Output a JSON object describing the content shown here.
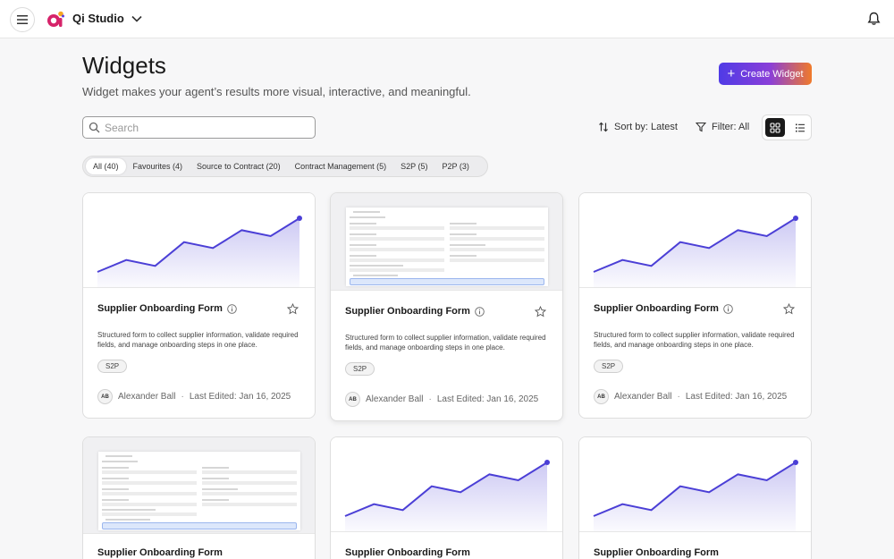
{
  "app": {
    "title": "Qi Studio",
    "logo_icon": "qi-logo-icon",
    "brand_colors": [
      "#d6236a",
      "#f6a623",
      "#5b3fe0"
    ]
  },
  "header": {
    "title": "Widgets",
    "subtitle": "Widget makes your agent’s results more visual, interactive, and meaningful.",
    "create_label": "Create Widget"
  },
  "search": {
    "placeholder": "Search",
    "value": ""
  },
  "toolbar": {
    "sort_label": "Sort by: Latest",
    "filter_label": "Filter: All",
    "view_mode": "grid"
  },
  "tabs": [
    {
      "label": "All (40)",
      "active": true
    },
    {
      "label": "Favourites (4)",
      "active": false
    },
    {
      "label": "Source to Contract (20)",
      "active": false
    },
    {
      "label": "Contract Management (5)",
      "active": false
    },
    {
      "label": "S2P (5)",
      "active": false
    },
    {
      "label": "P2P (3)",
      "active": false
    }
  ],
  "cards": [
    {
      "preview": "chart",
      "title": "Supplier Onboarding Form",
      "description": "Structured form to collect supplier information, validate required fields, and manage onboarding steps in one place.",
      "tag": "S2P",
      "author_initials": "AB",
      "author": "Alexander Ball",
      "edited": "Last Edited: Jan 16, 2025"
    },
    {
      "preview": "form",
      "title": "Supplier Onboarding Form",
      "description": "Structured form to collect supplier information, validate required fields, and manage onboarding steps in one place.",
      "tag": "S2P",
      "author_initials": "AB",
      "author": "Alexander Ball",
      "edited": "Last Edited: Jan 16, 2025"
    },
    {
      "preview": "chart",
      "title": "Supplier Onboarding Form",
      "description": "Structured form to collect supplier information, validate required fields, and manage onboarding steps in one place.",
      "tag": "S2P",
      "author_initials": "AB",
      "author": "Alexander Ball",
      "edited": "Last Edited: Jan 16, 2025"
    },
    {
      "preview": "form",
      "title": "Supplier Onboarding Form"
    },
    {
      "preview": "chart",
      "title": "Supplier Onboarding Form"
    },
    {
      "preview": "chart",
      "title": "Supplier Onboarding Form"
    }
  ],
  "thumbnail_line": {
    "values": [
      1,
      3,
      2,
      6,
      5,
      8,
      7,
      10
    ],
    "color": "#4b3fd6"
  },
  "colors": {
    "accent": "#4b3fd6",
    "active_view_bg": "#1a1a1a"
  }
}
